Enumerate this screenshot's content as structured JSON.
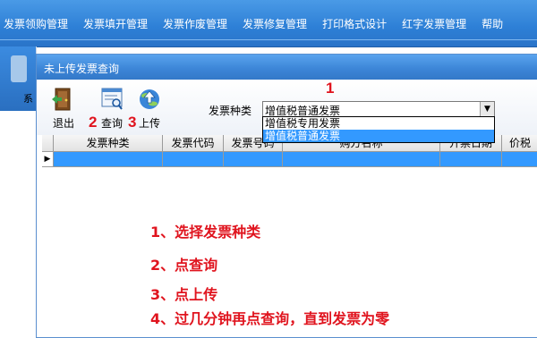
{
  "menu": [
    "发票领购管理",
    "发票填开管理",
    "发票作废管理",
    "发票修复管理",
    "打印格式设计",
    "红字发票管理",
    "帮助"
  ],
  "side_label": "系",
  "window": {
    "title": "未上传发票查询",
    "toolbar": {
      "exit": "退出",
      "query": "查询",
      "upload": "上传"
    },
    "markers": {
      "m1": "1",
      "m2": "2",
      "m3": "3"
    },
    "invoice_type": {
      "label": "发票种类",
      "value": "增值税普通发票",
      "options": [
        "增值税专用发票",
        "增值税普通发票"
      ]
    },
    "grid": {
      "columns": [
        "发票种类",
        "发票代码",
        "发票号码",
        "购方名称",
        "开票日期",
        "价税"
      ]
    }
  },
  "instructions": [
    "1、选择发票种类",
    "2、点查询",
    "3、点上传",
    "4、过几分钟再点查询，直到发票为零"
  ],
  "colors": {
    "accent": "#3399ff",
    "annotation": "#e0141e",
    "menubar": "#2d7fd6"
  }
}
